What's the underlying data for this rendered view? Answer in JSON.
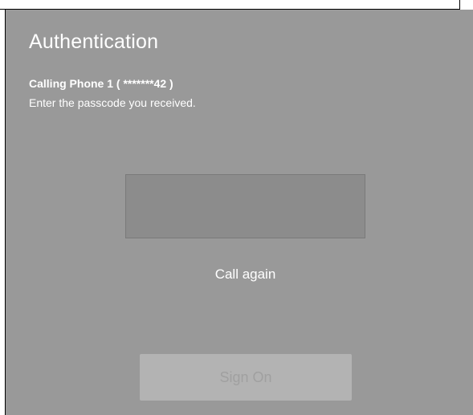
{
  "dialog": {
    "title": "Authentication",
    "calling_text": "Calling Phone 1 ( *******42 )",
    "instructions": "Enter the passcode you received.",
    "passcode": {
      "value": "",
      "placeholder": ""
    },
    "call_again_label": "Call again",
    "sign_on_label": "Sign On"
  },
  "colors": {
    "dialog_background": "#999999",
    "input_background": "#8c8c8c",
    "button_background": "#b3b3b3",
    "button_text": "#a0a0a0",
    "text": "#ffffff"
  }
}
